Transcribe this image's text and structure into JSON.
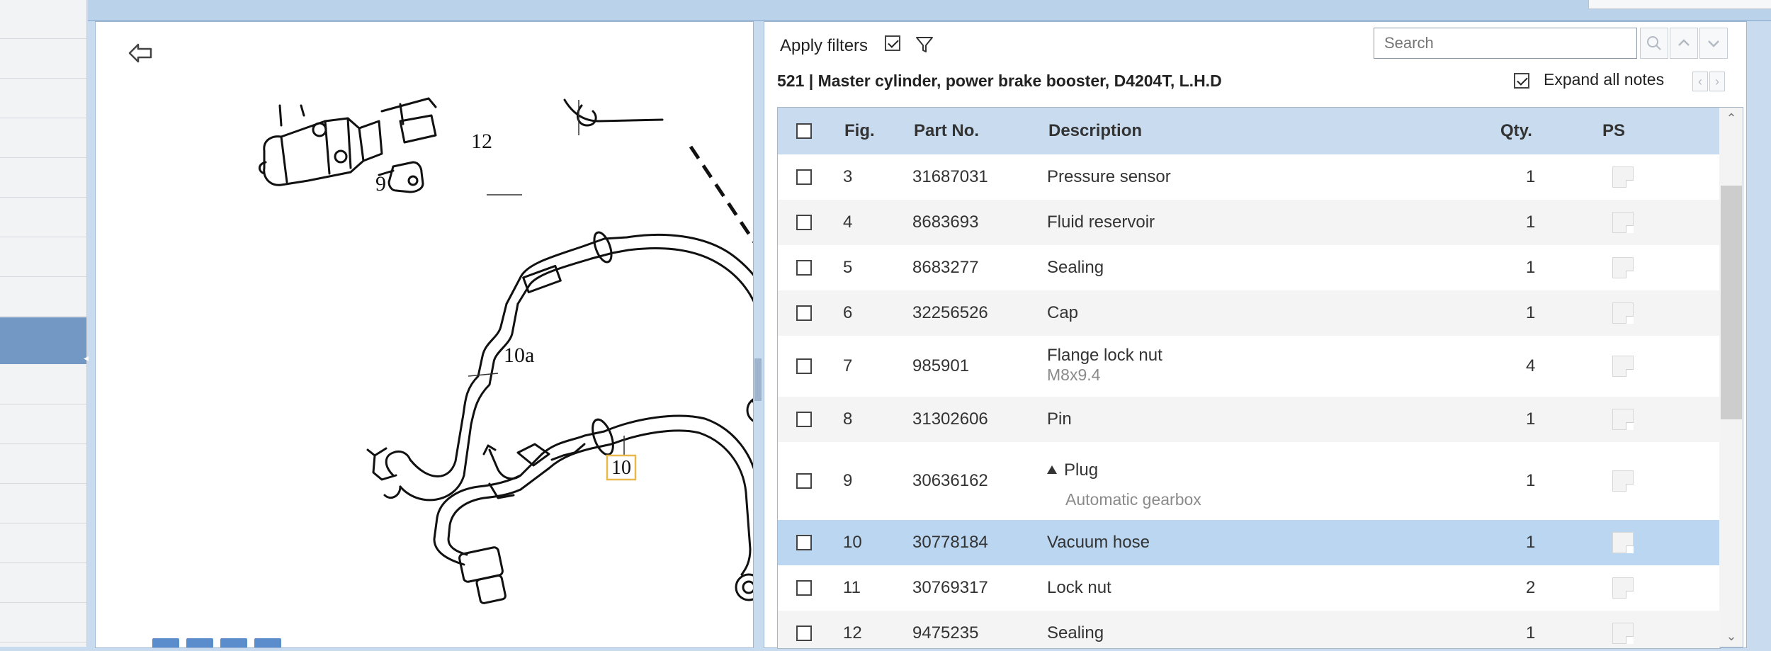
{
  "parts_panel": {
    "apply_filters_label": "Apply filters",
    "apply_filters_checked": true,
    "search_placeholder": "Search",
    "title": "521  |  Master cylinder, power brake booster, D4204T, L.H.D",
    "expand_all_notes_label": "Expand all notes",
    "expand_all_notes_checked": true,
    "columns": [
      "Fig.",
      "Part No.",
      "Description",
      "Qty.",
      "PS"
    ],
    "rows": [
      {
        "fig": "3",
        "part_no": "31687031",
        "description": "Pressure sensor",
        "note": "",
        "qty": "1"
      },
      {
        "fig": "4",
        "part_no": "8683693",
        "description": "Fluid reservoir",
        "note": "",
        "qty": "1"
      },
      {
        "fig": "5",
        "part_no": "8683277",
        "description": "Sealing",
        "note": "",
        "qty": "1"
      },
      {
        "fig": "6",
        "part_no": "32256526",
        "description": "Cap",
        "note": "",
        "qty": "1"
      },
      {
        "fig": "7",
        "part_no": "985901",
        "description": "Flange lock nut",
        "note": "M8x9.4",
        "qty": "4"
      },
      {
        "fig": "8",
        "part_no": "31302606",
        "description": "Pin",
        "note": "",
        "qty": "1"
      },
      {
        "fig": "9",
        "part_no": "30636162",
        "description": "Plug",
        "note": "Automatic gearbox",
        "qty": "1"
      },
      {
        "fig": "10",
        "part_no": "30778184",
        "description": "Vacuum hose",
        "note": "",
        "qty": "1",
        "selected": true
      },
      {
        "fig": "11",
        "part_no": "30769317",
        "description": "Lock nut",
        "note": "",
        "qty": "2"
      },
      {
        "fig": "12",
        "part_no": "9475235",
        "description": "Sealing",
        "note": "",
        "qty": "1"
      }
    ]
  },
  "diagram": {
    "callouts": {
      "c12": "12",
      "c9": "9",
      "c10a": "10a",
      "c10": "10"
    }
  },
  "colors": {
    "selected_row": "#bad6f0",
    "header_bg": "#c9dcef",
    "nav_selected": "#7398c4",
    "callout_highlight": "#e8b84a"
  }
}
